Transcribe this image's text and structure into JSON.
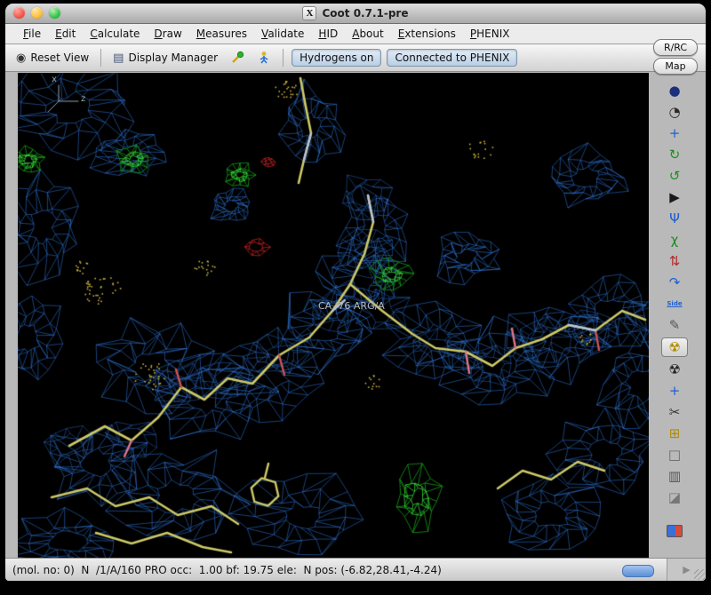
{
  "window": {
    "title": "Coot 0.7.1-pre",
    "x11_icon": "X"
  },
  "menubar": {
    "items": [
      "File",
      "Edit",
      "Calculate",
      "Draw",
      "Measures",
      "Validate",
      "HID",
      "About",
      "Extensions",
      "PHENIX"
    ]
  },
  "toolbar": {
    "reset_view_label": "Reset View",
    "display_manager_label": "Display Manager",
    "hydrogens_toggle_label": "Hydrogens on",
    "phenix_toggle_label": "Connected to PHENIX"
  },
  "side_buttons": {
    "rrc_label": "R/RC",
    "map_label": "Map"
  },
  "right_toolbar": {
    "icons": [
      {
        "name": "navigation-icon",
        "glyph": "●",
        "color": "#1c2f7e"
      },
      {
        "name": "clock-icon",
        "glyph": "◔",
        "color": "#2a2a2a"
      },
      {
        "name": "move-molecule-icon",
        "glyph": "+",
        "color": "#1f5fd0"
      },
      {
        "name": "refine-zone-icon",
        "glyph": "↻",
        "color": "#1d8f1d"
      },
      {
        "name": "torsion-icon",
        "glyph": "↺",
        "color": "#1d8f1d"
      },
      {
        "name": "play-icon",
        "glyph": "▶",
        "color": "#1a1a1a"
      },
      {
        "name": "rotamers-icon",
        "glyph": "Ψ",
        "color": "#1f5fd0"
      },
      {
        "name": "chi-angles-icon",
        "glyph": "χ",
        "color": "#1d8f1d"
      },
      {
        "name": "flip-peptide-icon",
        "glyph": "⇅",
        "color": "#b02a2a"
      },
      {
        "name": "auto-fit-rotamer-icon",
        "glyph": "↷",
        "color": "#1f5fd0"
      },
      {
        "name": "side-chain-flip-icon",
        "glyph": "Side",
        "color": "#1f5fd0"
      },
      {
        "name": "edit-backbone-icon",
        "glyph": "✎",
        "color": "#555555"
      },
      {
        "name": "real-space-refine-icon",
        "glyph": "☢",
        "color": "#b08a00",
        "selected": true
      },
      {
        "name": "regularize-icon",
        "glyph": "☢",
        "color": "#222222"
      },
      {
        "name": "add-terminal-icon",
        "glyph": "+",
        "color": "#1f5fd0"
      },
      {
        "name": "cut-icon",
        "glyph": "✂",
        "color": "#333333"
      },
      {
        "name": "add-alt-conf-icon",
        "glyph": "⊞",
        "color": "#b08a00"
      },
      {
        "name": "placeholder-icon",
        "glyph": "□",
        "color": "#666666"
      },
      {
        "name": "delete-icon",
        "glyph": "▥",
        "color": "#555555"
      },
      {
        "name": "eraser-icon",
        "glyph": "◪",
        "color": "#777777"
      },
      {
        "name": "picture-icon",
        "type": "swatch",
        "colors": [
          "#3a6fd8",
          "#d84a3a"
        ],
        "gap": true
      }
    ]
  },
  "viewport": {
    "residue_label": "CA /76 ARG/A",
    "axis_labels": {
      "x": "x",
      "z": "z"
    },
    "colors": {
      "density": "#2e74d8",
      "positive": "#17a517",
      "positive_bright": "#3ae03a",
      "negative": "#cc2222",
      "carbon": "#cdc968",
      "oxygen": "#cc5555",
      "polar": "#dd7788",
      "backbone_light": "#b9c4d8",
      "dots": "#c9b23c",
      "axes": "#93a3b3",
      "label": "#b9b9b9"
    }
  },
  "statusbar": {
    "text": "(mol. no: 0)  N  /1/A/160 PRO occ:  1.00 bf: 19.75 ele:  N pos: (-6.82,28.41,-4.24)"
  }
}
